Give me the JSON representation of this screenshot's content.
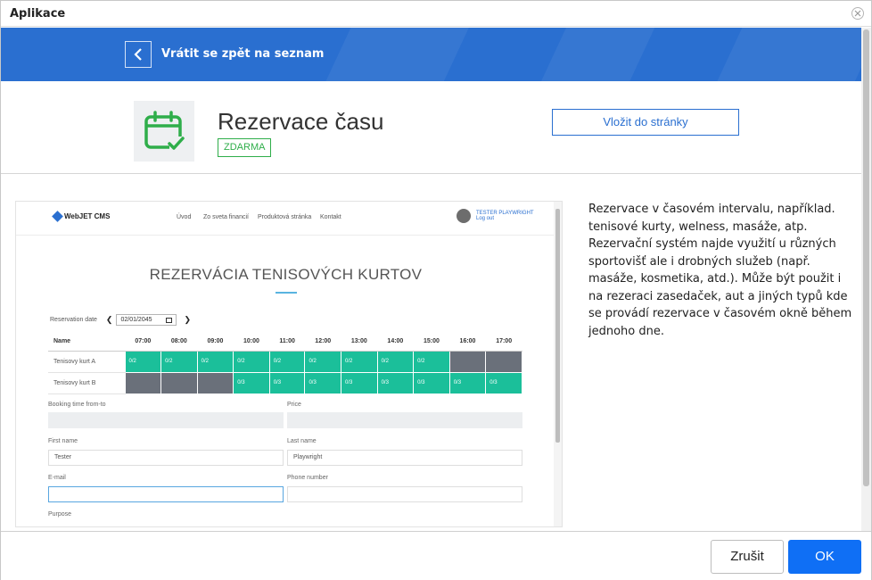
{
  "window": {
    "title": "Aplikace"
  },
  "banner": {
    "back_label": "Vrátit se zpět na seznam"
  },
  "app": {
    "title": "Rezervace času",
    "badge": "ZDARMA",
    "insert_button": "Vložit do stránky",
    "description": "Rezervace v časovém intervalu, například. tenisové kurty, welness, masáže, atp. Rezervační systém najde využití u různých sportovišť ale i drobných služeb (např. masáže, kosmetika, atd.). Může být použit i na rezeraci zasedaček, aut a jiných typů kde se provádí rezervace v časovém okně během jednoho dne."
  },
  "preview": {
    "logo": "WebJET CMS",
    "menu": [
      "Úvod",
      "Zo sveta financií",
      "Produktová stránka",
      "Kontakt"
    ],
    "user": {
      "name": "TESTER PLAYWRIGHT",
      "logout": "Log out"
    },
    "heading": "REZERVÁCIA TENISOVÝCH KURTOV",
    "date_label": "Reservation date",
    "date_value": "02/01/2045",
    "table": {
      "name_header": "Name",
      "times": [
        "07:00",
        "08:00",
        "09:00",
        "10:00",
        "11:00",
        "12:00",
        "13:00",
        "14:00",
        "15:00",
        "16:00",
        "17:00"
      ],
      "rows": [
        {
          "name": "Tenisovy kurt A",
          "cells": [
            "0/2",
            "0/2",
            "0/2",
            "0/2",
            "0/2",
            "0/2",
            "0/2",
            "0/2",
            "0/2",
            "",
            ""
          ],
          "states": [
            "free",
            "free",
            "free",
            "free",
            "free",
            "free",
            "free",
            "free",
            "free",
            "busy",
            "busy"
          ]
        },
        {
          "name": "Tenisovy kurt B",
          "cells": [
            "",
            "",
            "",
            "0/3",
            "0/3",
            "0/3",
            "0/3",
            "0/3",
            "0/3",
            "0/3",
            "0/3"
          ],
          "states": [
            "busy",
            "busy",
            "busy",
            "free",
            "free",
            "free",
            "free",
            "free",
            "free",
            "free",
            "free"
          ]
        }
      ]
    },
    "form": {
      "booking_label": "Booking time from-to",
      "price_label": "Price",
      "first_name_label": "First name",
      "first_name_value": "Tester",
      "last_name_label": "Last name",
      "last_name_value": "Playwright",
      "email_label": "E-mail",
      "phone_label": "Phone number",
      "purpose_label": "Purpose"
    }
  },
  "footer": {
    "cancel": "Zrušit",
    "ok": "OK"
  },
  "colors": {
    "brand_blue": "#2a6fd0",
    "ok_blue": "#0f6ff5",
    "free_slot": "#1bbf9a",
    "busy_slot": "#6a707a",
    "badge_green": "#2fae4a"
  }
}
